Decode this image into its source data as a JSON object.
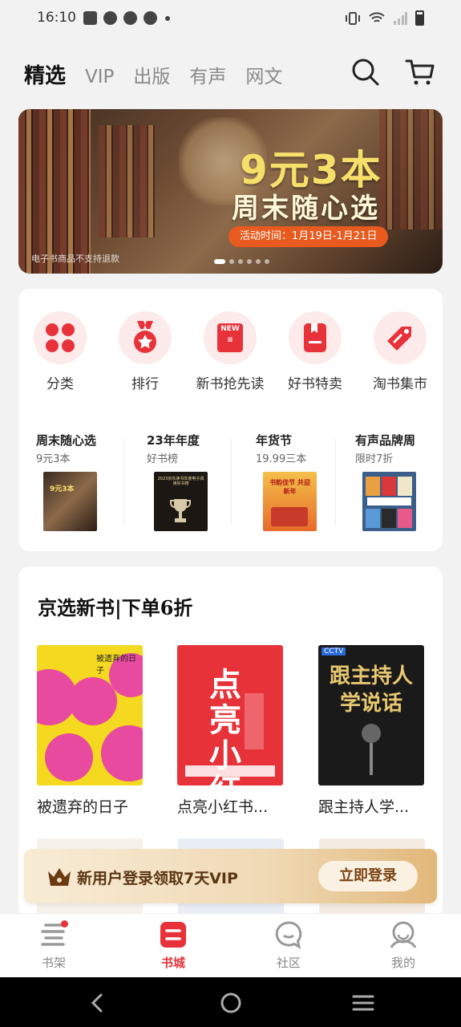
{
  "status_bar": {
    "time": "16:10"
  },
  "top_nav": {
    "tabs": [
      "精选",
      "VIP",
      "出版",
      "有声",
      "网文"
    ],
    "active_tab": "精选"
  },
  "banner": {
    "title": "9元3本",
    "subtitle": "周末随心选",
    "activity_time": "活动时间：1月19日-1月21日",
    "note": "电子书商品不支持退款"
  },
  "categories": [
    {
      "label": "分类",
      "icon": "grid-icon"
    },
    {
      "label": "排行",
      "icon": "medal-icon"
    },
    {
      "label": "新书抢先读",
      "icon": "new-book-icon"
    },
    {
      "label": "好书特卖",
      "icon": "book-sale-icon"
    },
    {
      "label": "淘书集市",
      "icon": "tag-icon"
    }
  ],
  "promos": [
    {
      "title": "周末随心选",
      "subtitle": "9元3本",
      "thumb_text": "9元3本"
    },
    {
      "title": "23年年度",
      "subtitle": "好书榜",
      "thumb_text": "2023京东读书年度电子阅读好书榜"
    },
    {
      "title": "年货节",
      "subtitle": "19.99三本",
      "thumb_text": "书韵佳节 共迎新年"
    },
    {
      "title": "有声品牌周",
      "subtitle": "限时7折",
      "thumb_text": ""
    }
  ],
  "new_books": {
    "title": "京选新书|下单6折",
    "books": [
      {
        "name": "被遗弃的日子",
        "cover_text": "被遗弃的日子"
      },
      {
        "name": "点亮小红书...",
        "cover_text": "点亮小红书"
      },
      {
        "name": "跟主持人学...",
        "cover_text": "跟主持人学说话"
      }
    ]
  },
  "login_bar": {
    "text": "新用户登录领取7天VIP",
    "button": "立即登录"
  },
  "bottom_tabs": [
    {
      "label": "书架",
      "icon": "bookshelf-icon"
    },
    {
      "label": "书城",
      "icon": "bookstore-icon"
    },
    {
      "label": "社区",
      "icon": "community-icon"
    },
    {
      "label": "我的",
      "icon": "profile-icon"
    }
  ],
  "active_bottom_tab": "书城",
  "colors": {
    "accent": "#e8323a",
    "vip_gold": "#efd9b4"
  }
}
